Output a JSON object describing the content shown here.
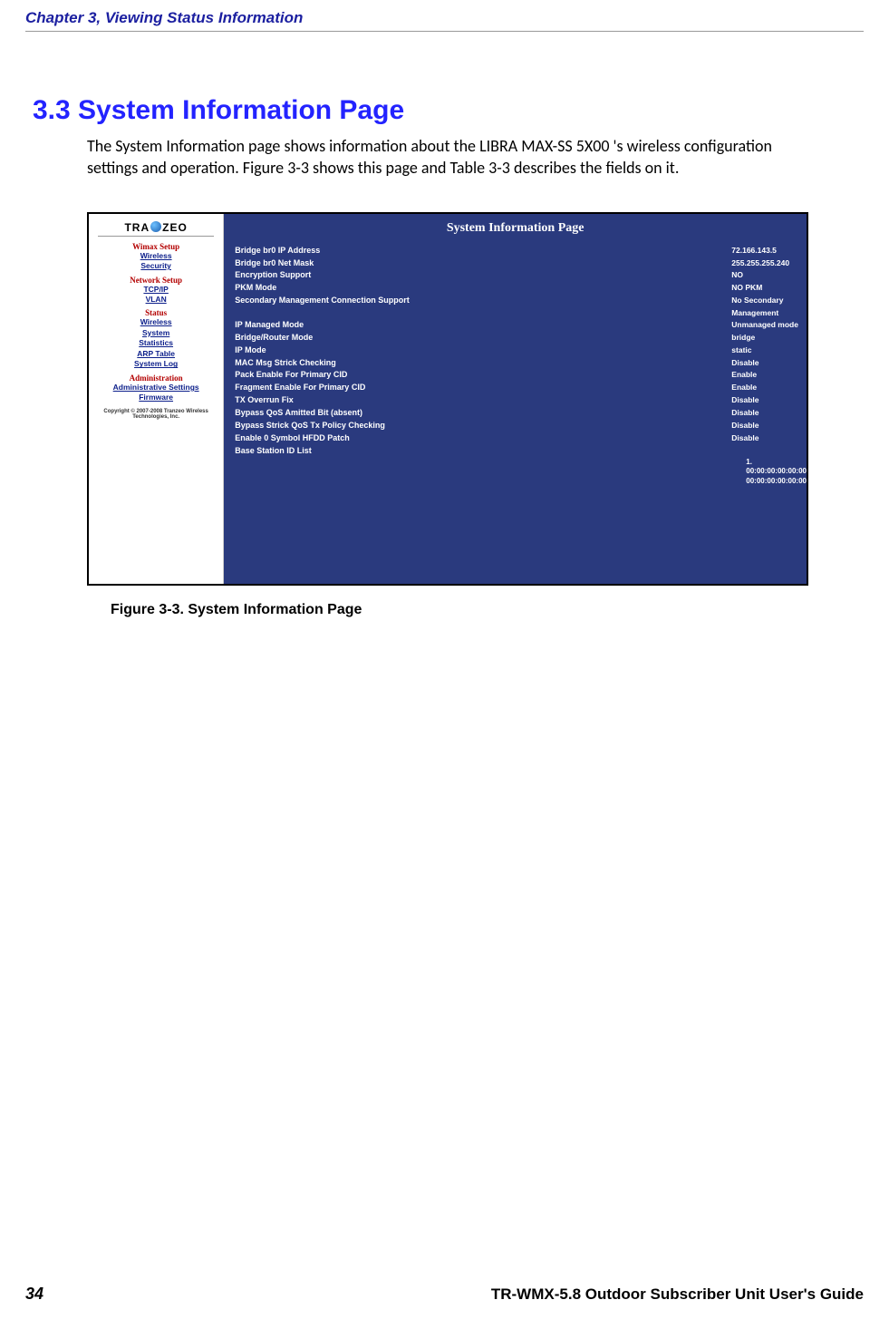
{
  "chapter_header": "Chapter 3, Viewing Status Information",
  "section_title": "3.3 System Information Page",
  "body_text": "The System Information page shows information about the LIBRA MAX-SS 5X00 's wireless configuration settings and operation. Figure 3-3 shows this page and Table 3-3 describes the fields on it.",
  "figure_caption": "Figure 3-3. System Information Page",
  "footer": {
    "page_number": "34",
    "title": "TR-WMX-5.8 Outdoor Subscriber Unit User's Guide"
  },
  "screenshot": {
    "logo_left": "TRA",
    "logo_right": "ZEO",
    "page_title": "System Information Page",
    "sidebar": {
      "groups": [
        {
          "title": "Wimax Setup",
          "links": [
            "Wireless",
            "Security"
          ]
        },
        {
          "title": "Network Setup",
          "links": [
            "TCP/IP",
            "VLAN"
          ]
        },
        {
          "title": "Status",
          "links": [
            "Wireless",
            "System",
            "Statistics",
            "ARP Table",
            "System Log"
          ]
        },
        {
          "title": "Administration",
          "links": [
            "Administrative Settings",
            "Firmware"
          ]
        }
      ],
      "copyright_l1": "Copyright © 2007-2008 Tranzeo Wireless",
      "copyright_l2": "Technologies, Inc."
    },
    "fields": [
      {
        "label": "Bridge br0 IP Address",
        "value": "72.166.143.5"
      },
      {
        "label": "Bridge br0 Net Mask",
        "value": "255.255.255.240"
      },
      {
        "label": "Encryption Support",
        "value": "NO"
      },
      {
        "label": "PKM Mode",
        "value": "NO PKM"
      },
      {
        "label": "Secondary Management Connection Support",
        "value": "No Secondary Management"
      },
      {
        "label": "IP Managed Mode",
        "value": "Unmanaged mode"
      },
      {
        "label": "Bridge/Router Mode",
        "value": "bridge"
      },
      {
        "label": "IP Mode",
        "value": "static"
      },
      {
        "label": "MAC Msg Strick Checking",
        "value": "Disable"
      },
      {
        "label": "Pack Enable For Primary CID",
        "value": "Enable"
      },
      {
        "label": "Fragment Enable For Primary CID",
        "value": "Enable"
      },
      {
        "label": "TX Overrun Fix",
        "value": "Disable"
      },
      {
        "label": "Bypass QoS Amitted Bit (absent)",
        "value": "Disable"
      },
      {
        "label": "Bypass Strick QoS Tx Policy Checking",
        "value": "Disable"
      },
      {
        "label": "Enable 0 Symbol HFDD Patch",
        "value": "Disable"
      },
      {
        "label": "Base Station ID List",
        "value": ""
      }
    ],
    "bs_list_item": "1.   00:00:00:00:00:00 00:00:00:00:00:00"
  }
}
